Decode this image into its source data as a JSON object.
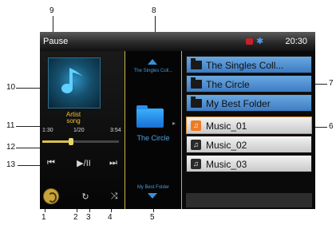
{
  "status": {
    "text": "Pause",
    "time": "20:30",
    "rec_icon": "record-icon",
    "bt_icon": "bluetooth-icon"
  },
  "player": {
    "artist": "Artist",
    "song": "song",
    "elapsed": "1:30",
    "track_position": "1/20",
    "total": "3:54",
    "progress": 0.38,
    "art_icon": "music-note-icon"
  },
  "controls": {
    "prev": "⏮",
    "play_pause": "▶/II",
    "next": "⏭",
    "repeat": "↻",
    "shuffle": "⤨"
  },
  "folder_nav": {
    "up_label": "The Singles Coll...",
    "current": "The Circle",
    "down_label": "My Best Folder"
  },
  "list": {
    "items": [
      {
        "label": "The Singles Coll...",
        "type": "folder"
      },
      {
        "label": "The Circle",
        "type": "folder"
      },
      {
        "label": "My Best Folder",
        "type": "folder"
      },
      {
        "label": "Music_01",
        "type": "file",
        "active": true
      },
      {
        "label": "Music_02",
        "type": "file"
      },
      {
        "label": "Music_03",
        "type": "file"
      }
    ]
  },
  "callouts": [
    "1",
    "2",
    "3",
    "4",
    "5",
    "6",
    "7",
    "8",
    "9",
    "10",
    "11",
    "12",
    "13"
  ],
  "colors": {
    "accent_gold": "#c8b44a",
    "folder_blue": "#3d7cc4",
    "active_orange": "#f07a22"
  }
}
